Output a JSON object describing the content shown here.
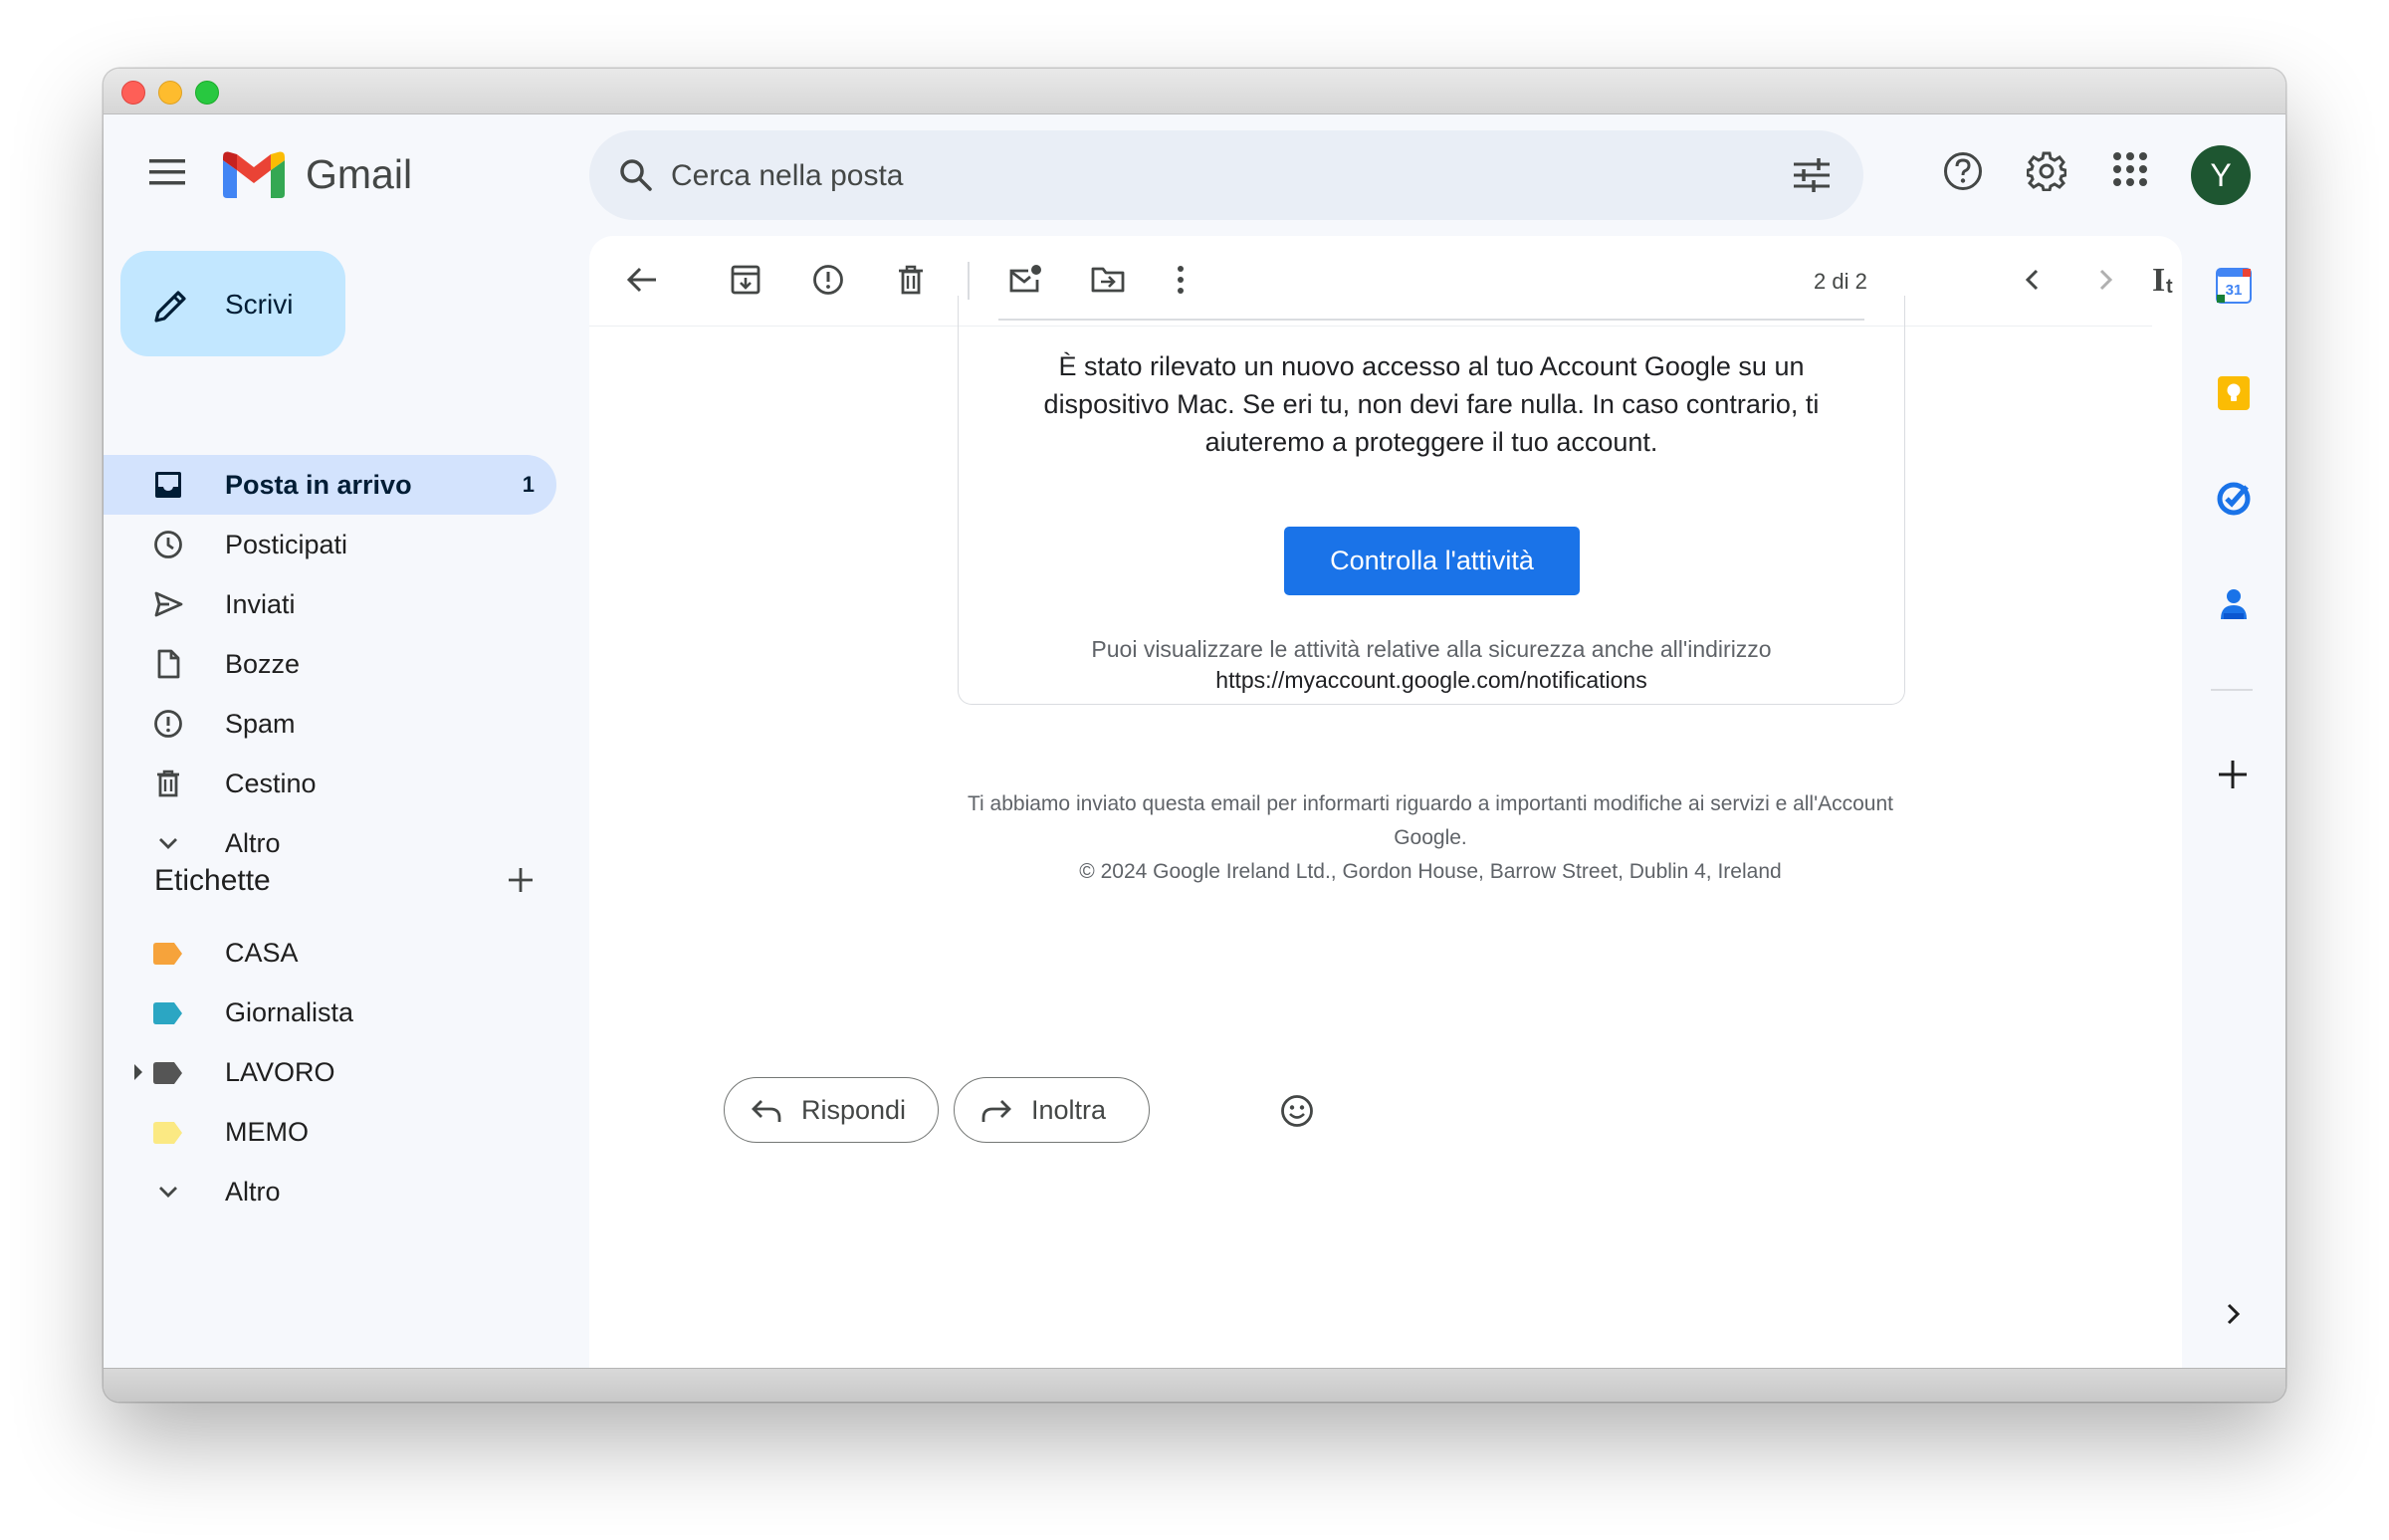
{
  "app": {
    "name": "Gmail"
  },
  "search": {
    "placeholder": "Cerca nella posta"
  },
  "account": {
    "initial": "Y",
    "color": "#1e5631"
  },
  "compose": {
    "label": "Scrivi"
  },
  "nav": [
    {
      "id": "inbox",
      "label": "Posta in arrivo",
      "count": "1",
      "icon": "inbox-icon",
      "active": true
    },
    {
      "id": "snoozed",
      "label": "Posticipati",
      "icon": "clock-icon"
    },
    {
      "id": "sent",
      "label": "Inviati",
      "icon": "send-icon"
    },
    {
      "id": "drafts",
      "label": "Bozze",
      "icon": "draft-icon"
    },
    {
      "id": "spam",
      "label": "Spam",
      "icon": "spam-icon"
    },
    {
      "id": "trash",
      "label": "Cestino",
      "icon": "trash-icon"
    },
    {
      "id": "more",
      "label": "Altro",
      "icon": "chevron-down-icon"
    }
  ],
  "labels": {
    "title": "Etichette",
    "items": [
      {
        "label": "CASA",
        "color": "#f6a33b"
      },
      {
        "label": "Giornalista",
        "color": "#2ba6c3"
      },
      {
        "label": "LAVORO",
        "color": "#555555"
      },
      {
        "label": "MEMO",
        "color": "#fbe983"
      }
    ],
    "more": "Altro"
  },
  "toolbar": {
    "pager": "2 di 2"
  },
  "email": {
    "message": "È stato rilevato un nuovo accesso al tuo Account Google su un dispositivo Mac. Se eri tu, non devi fare nulla. In caso contrario, ti aiuteremo a proteggere il tuo account.",
    "button": "Controlla l'attività",
    "note": "Puoi visualizzare le attività relative alla sicurezza anche all'indirizzo",
    "url": "https://myaccount.google.com/notifications",
    "footer_line1": "Ti abbiamo inviato questa email per informarti riguardo a importanti modifiche ai servizi e all'Account Google.",
    "footer_line2": "© 2024 Google Ireland Ltd., Gordon House, Barrow Street, Dublin 4, Ireland"
  },
  "actions": {
    "reply": "Rispondi",
    "forward": "Inoltra"
  },
  "colors": {
    "accent": "#1a73e8",
    "compose_bg": "#c2e7ff",
    "active_nav": "#d3e3fd"
  }
}
